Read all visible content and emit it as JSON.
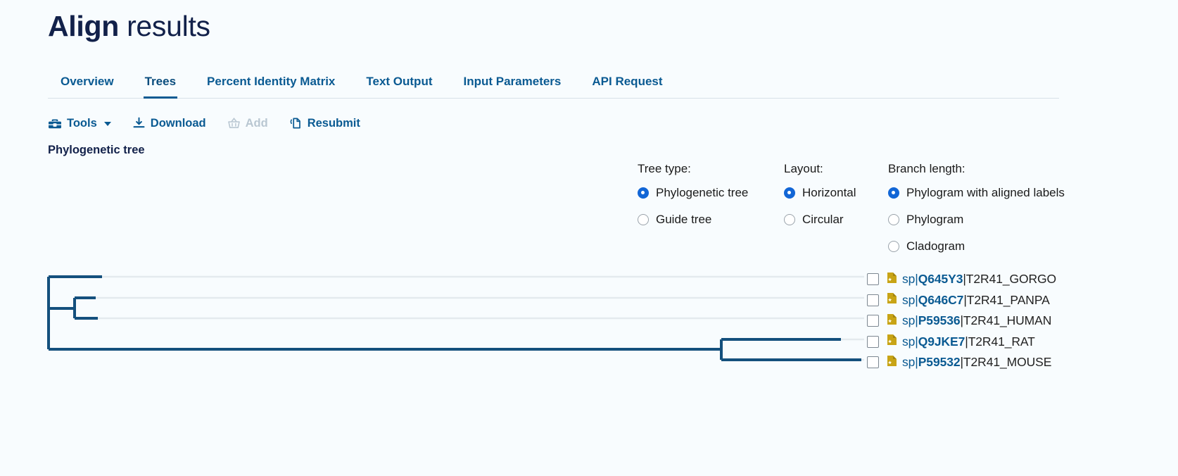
{
  "header": {
    "title_strong": "Align",
    "title_light": "results"
  },
  "tabs": [
    {
      "label": "Overview",
      "active": false
    },
    {
      "label": "Trees",
      "active": true
    },
    {
      "label": "Percent Identity Matrix",
      "active": false
    },
    {
      "label": "Text Output",
      "active": false
    },
    {
      "label": "Input Parameters",
      "active": false
    },
    {
      "label": "API Request",
      "active": false
    }
  ],
  "toolbar": {
    "tools_label": "Tools",
    "download_label": "Download",
    "add_label": "Add",
    "resubmit_label": "Resubmit",
    "icons": {
      "tools": "toolbox-icon",
      "tools_caret": "chevron-down-icon",
      "download": "download-icon",
      "add": "basket-icon",
      "resubmit": "copy-document-icon"
    }
  },
  "section": {
    "heading": "Phylogenetic tree"
  },
  "options": {
    "tree_type": {
      "title": "Tree type:",
      "items": [
        {
          "label": "Phylogenetic tree",
          "selected": true
        },
        {
          "label": "Guide tree",
          "selected": false
        }
      ]
    },
    "layout": {
      "title": "Layout:",
      "items": [
        {
          "label": "Horizontal",
          "selected": true
        },
        {
          "label": "Circular",
          "selected": false
        }
      ]
    },
    "branch_length": {
      "title": "Branch length:",
      "items": [
        {
          "label": "Phylogram with aligned labels",
          "selected": true
        },
        {
          "label": "Phylogram",
          "selected": false
        },
        {
          "label": "Cladogram",
          "selected": false
        }
      ]
    }
  },
  "tree": {
    "leaves": [
      {
        "db": "sp|",
        "accession": "Q645Y3",
        "suffix": "|T2R41_GORGO",
        "checked": false
      },
      {
        "db": "sp|",
        "accession": "Q646C7",
        "suffix": "|T2R41_PANPA",
        "checked": false
      },
      {
        "db": "sp|",
        "accession": "P59536",
        "suffix": "|T2R41_HUMAN",
        "checked": false
      },
      {
        "db": "sp|",
        "accession": "Q9JKE7",
        "suffix": "|T2R41_RAT",
        "checked": false
      },
      {
        "db": "sp|",
        "accession": "P59532",
        "suffix": "|T2R41_MOUSE",
        "checked": false
      }
    ]
  },
  "colors": {
    "brand_blue": "#0a5a92",
    "title_navy": "#12214a",
    "branch": "#14507d",
    "leader": "#e4eaee",
    "radio_selected": "#1266d6",
    "uniprot_gold": "#c8a415",
    "page_bg": "#f8fcfe"
  }
}
